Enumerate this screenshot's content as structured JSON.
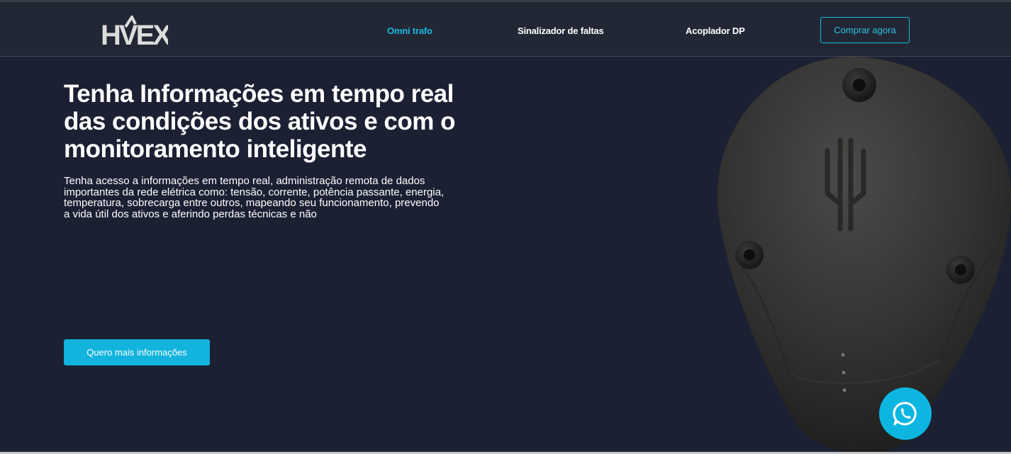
{
  "header": {
    "logo_text": "HVEX",
    "nav": [
      {
        "label": "Omni trafo",
        "active": true
      },
      {
        "label": "Sinalizador de faltas",
        "active": false
      },
      {
        "label": "Acoplador DP",
        "active": false
      }
    ],
    "buy_label": "Comprar agora"
  },
  "hero": {
    "title_lines": [
      "Tenha Informações em tempo real",
      "das condições dos ativos e com o",
      "monitoramento inteligente"
    ],
    "text_lines": [
      "Tenha acesso a informações em tempo real, administração remota de dados",
      "importantes da rede elétrica como: tensão, corrente, potência passante, energia,",
      "temperatura, sobrecarga entre outros, mapeando seu funcionamento, prevendo",
      "a vida útil dos ativos e aferindo perdas técnicas e não"
    ],
    "cta_label": "Quero mais informações"
  },
  "product_image": {
    "icon": "omni-trafo-device-image"
  },
  "floating": {
    "icon": "whatsapp-icon"
  },
  "colors": {
    "background": "#1b2033",
    "navbar": "#222735",
    "accent": "#12b3dd"
  }
}
